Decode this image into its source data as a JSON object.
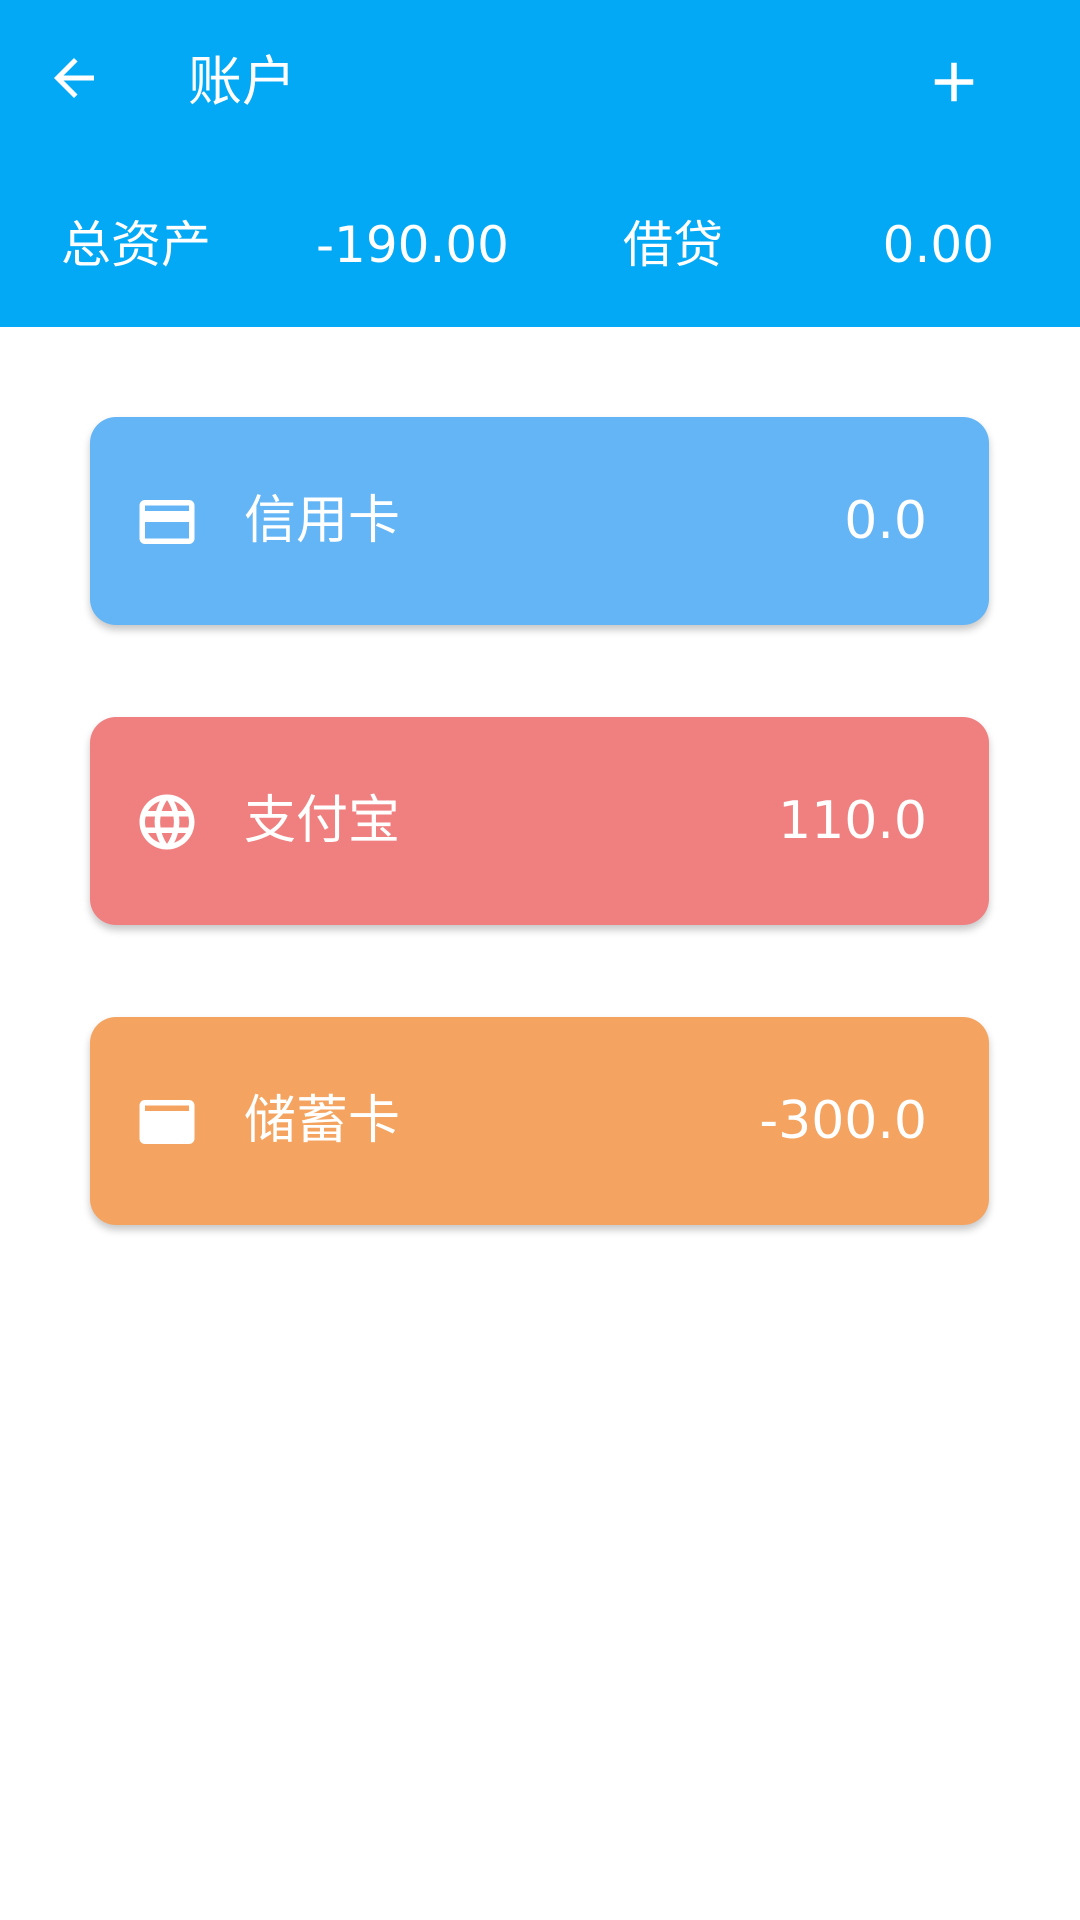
{
  "header": {
    "title": "账户",
    "back_icon": "arrow-left-icon",
    "add_icon": "plus-icon",
    "background_color": "#03A9F4"
  },
  "summary": {
    "total_assets_label": "总资产",
    "total_assets_value": "-190.00",
    "debt_label": "借贷",
    "debt_value": "0.00"
  },
  "accounts": [
    {
      "name": "信用卡",
      "amount": "0.0",
      "icon": "credit-card-icon",
      "color": "#64B5F6"
    },
    {
      "name": "支付宝",
      "amount": "110.0",
      "icon": "globe-icon",
      "color": "#F08080"
    },
    {
      "name": "储蓄卡",
      "amount": "-300.0",
      "icon": "card-icon",
      "color": "#F4A460"
    }
  ]
}
